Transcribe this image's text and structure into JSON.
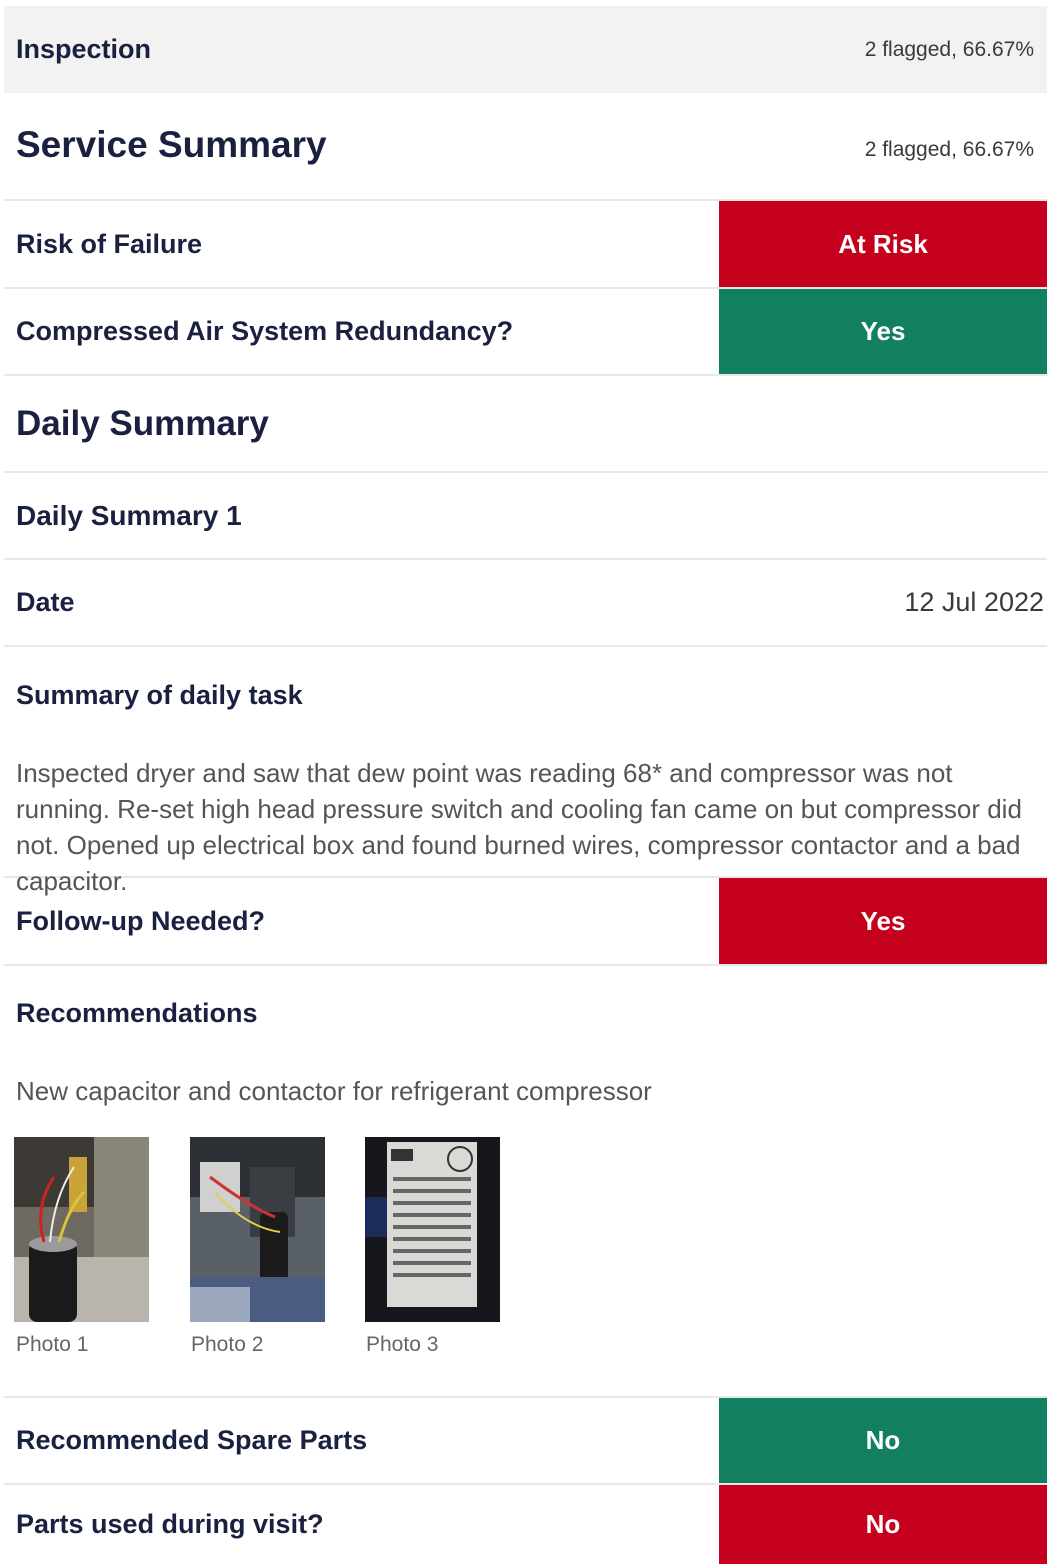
{
  "header": {
    "title": "Inspection",
    "stats": "2 flagged, 66.67%"
  },
  "service_summary": {
    "title": "Service Summary",
    "stats": "2 flagged, 66.67%"
  },
  "rows": {
    "risk": {
      "label": "Risk of Failure",
      "value": "At Risk",
      "color": "#c4001d"
    },
    "redundancy": {
      "label": "Compressed Air System Redundancy?",
      "value": "Yes",
      "color": "#128060"
    }
  },
  "daily_summary": {
    "title": "Daily Summary",
    "subtitle": "Daily Summary 1",
    "date_label": "Date",
    "date_value": "12 Jul 2022",
    "task_label": "Summary of daily task",
    "task_text": "Inspected dryer and saw that dew point was reading 68* and compressor was not running. Re-set high head pressure switch and cooling fan came on but compressor did not. Opened up electrical box and found burned wires, compressor contactor and a bad capacitor.",
    "followup": {
      "label": "Follow-up Needed?",
      "value": "Yes",
      "color": "#c4001d"
    },
    "recommendations_label": "Recommendations",
    "recommendations_text": "New capacitor and contactor for refrigerant compressor",
    "photos": [
      {
        "caption": "Photo 1",
        "icon": "capacitor-photo"
      },
      {
        "caption": "Photo 2",
        "icon": "electrical-box-photo"
      },
      {
        "caption": "Photo 3",
        "icon": "nameplate-photo"
      }
    ],
    "spare_parts": {
      "label": "Recommended Spare Parts",
      "value": "No",
      "color": "#128060"
    },
    "parts_used": {
      "label": "Parts used during visit?",
      "value": "No",
      "color": "#c4001d"
    }
  }
}
